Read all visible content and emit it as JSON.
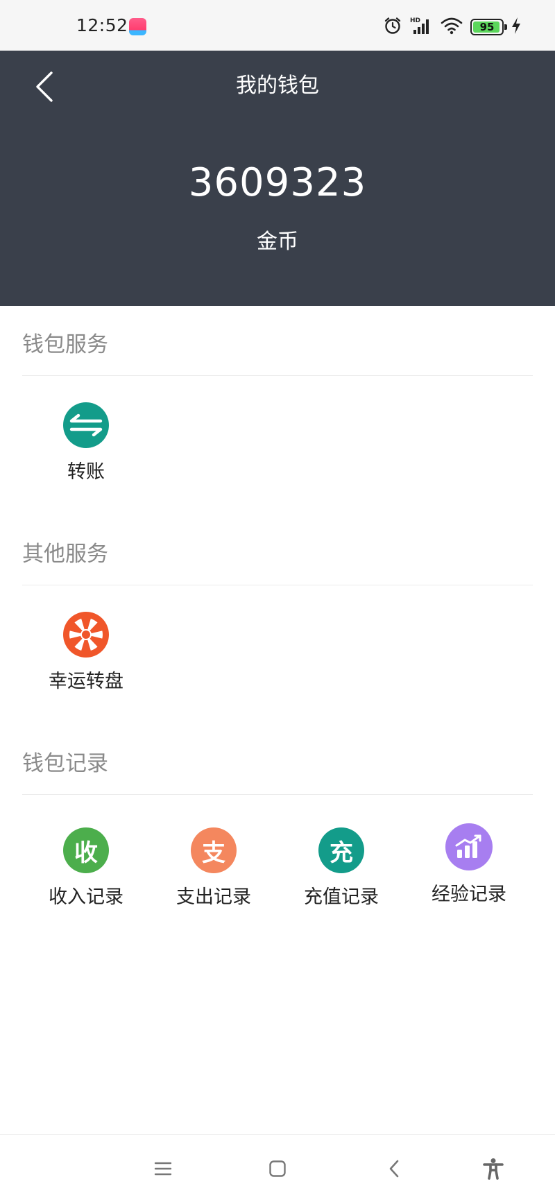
{
  "status_bar": {
    "time": "12:52",
    "battery_level": 95,
    "icons": [
      "app-icon",
      "alarm-icon",
      "hd-signal-icon",
      "wifi-icon",
      "battery-icon",
      "charging-icon"
    ]
  },
  "header": {
    "title": "我的钱包",
    "balance": "3609323",
    "unit": "金币",
    "background_color": "#3a404b"
  },
  "sections": {
    "wallet_services": {
      "title": "钱包服务",
      "items": [
        {
          "label": "转账",
          "icon": "transfer-icon",
          "color": "#139c8a"
        }
      ]
    },
    "other_services": {
      "title": "其他服务",
      "items": [
        {
          "label": "幸运转盘",
          "icon": "lucky-wheel-icon",
          "color": "#f0562a"
        }
      ]
    },
    "wallet_records": {
      "title": "钱包记录",
      "items": [
        {
          "label": "收入记录",
          "icon_text": "收",
          "icon": "income-icon",
          "color": "#4cae4c"
        },
        {
          "label": "支出记录",
          "icon_text": "支",
          "icon": "expense-icon",
          "color": "#f4875e"
        },
        {
          "label": "充值记录",
          "icon_text": "充",
          "icon": "recharge-icon",
          "color": "#139c8a"
        },
        {
          "label": "经验记录",
          "icon": "experience-chart-icon",
          "color": "#a77ef0"
        }
      ]
    }
  },
  "nav_bar": {
    "icons": [
      "menu-icon",
      "home-icon",
      "back-icon",
      "accessibility-icon"
    ]
  }
}
